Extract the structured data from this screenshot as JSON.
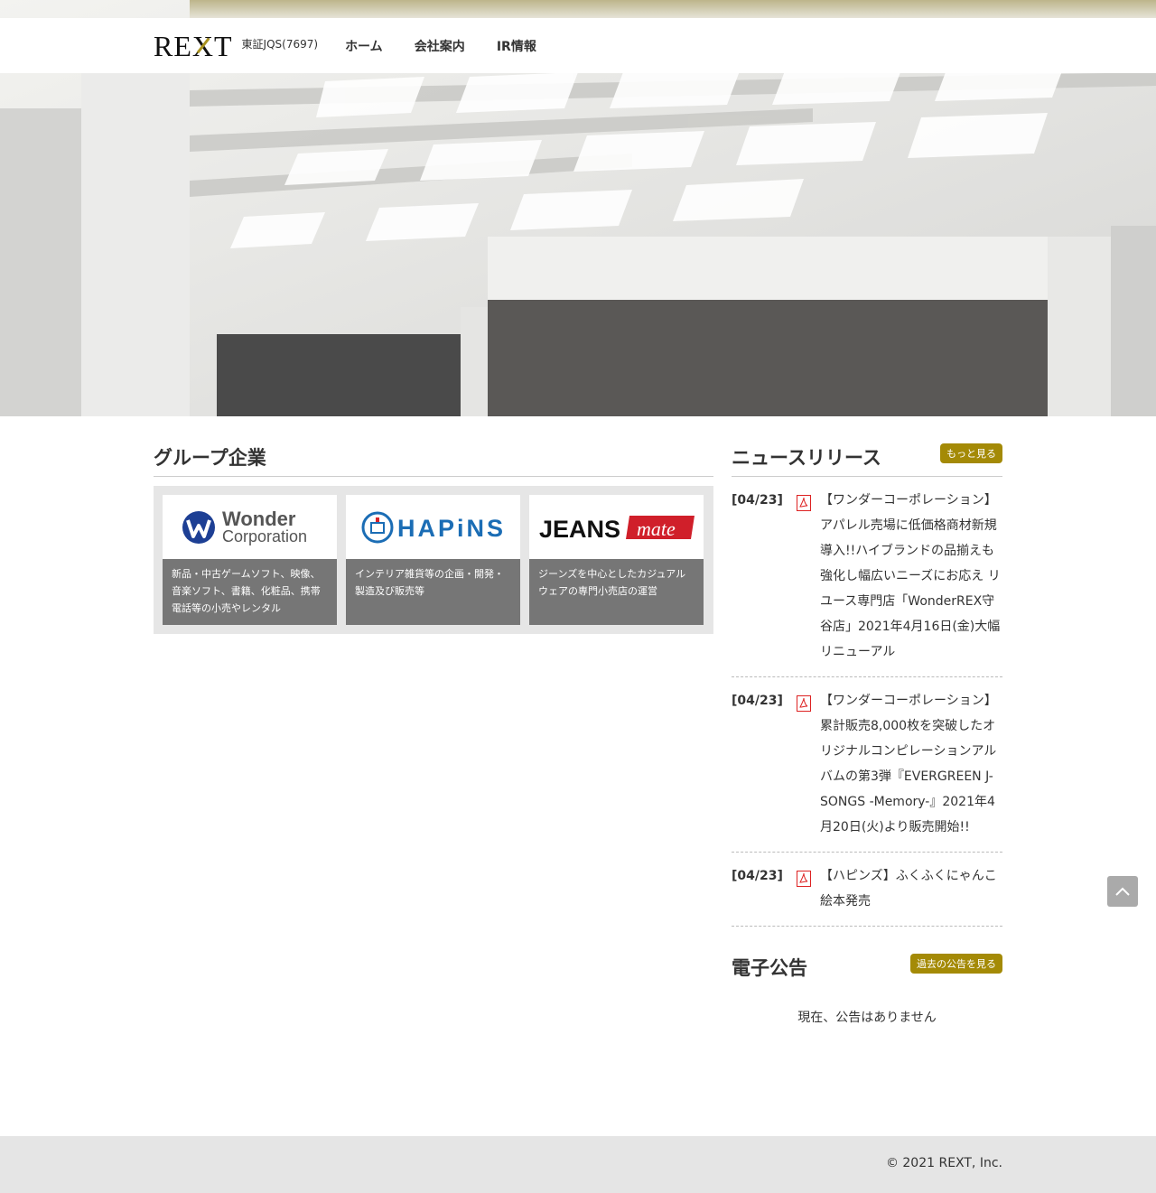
{
  "header": {
    "logo": "REXT",
    "ticker": "東証JQS(7697)",
    "nav": [
      "ホーム",
      "会社案内",
      "IR情報"
    ]
  },
  "group": {
    "title": "グループ企業",
    "cards": [
      {
        "logo_line1": "Wonder",
        "logo_line2": "Corporation",
        "desc": "新品・中古ゲームソフト、映像、音楽ソフト、書籍、化粧品、携帯電話等の小売やレンタル"
      },
      {
        "logo": "HAPiNS",
        "desc": "インテリア雑貨等の企画・開発・製造及び販売等"
      },
      {
        "logo_main": "JEANS",
        "logo_sub": "mate",
        "desc": "ジーンズを中心としたカジュアルウェアの専門小売店の運営"
      }
    ]
  },
  "news": {
    "title": "ニュースリリース",
    "more_label": "もっと見る",
    "items": [
      {
        "date": "[04/23]",
        "text": "【ワンダーコーポレーション】アパレル売場に低価格商材新規導入!!ハイブランドの品揃えも強化し幅広いニーズにお応え リユース専門店「WonderREX守谷店」2021年4月16日(金)大幅リニューアル"
      },
      {
        "date": "[04/23]",
        "text": "【ワンダーコーポレーション】累計販売8,000枚を突破したオリジナルコンピレーションアルバムの第3弾『EVERGREEN J-SONGS -Memory-』2021年4月20日(火)より販売開始!!"
      },
      {
        "date": "[04/23]",
        "text": "【ハピンズ】ふくふくにゃんこ絵本発売"
      }
    ]
  },
  "koukoku": {
    "title": "電子公告",
    "past_label": "過去の公告を見る",
    "message": "現在、公告はありません"
  },
  "footer": {
    "copyright": "© 2021 REXT, Inc."
  },
  "colors": {
    "accent": "#a48a06",
    "card_bg": "#767676"
  }
}
